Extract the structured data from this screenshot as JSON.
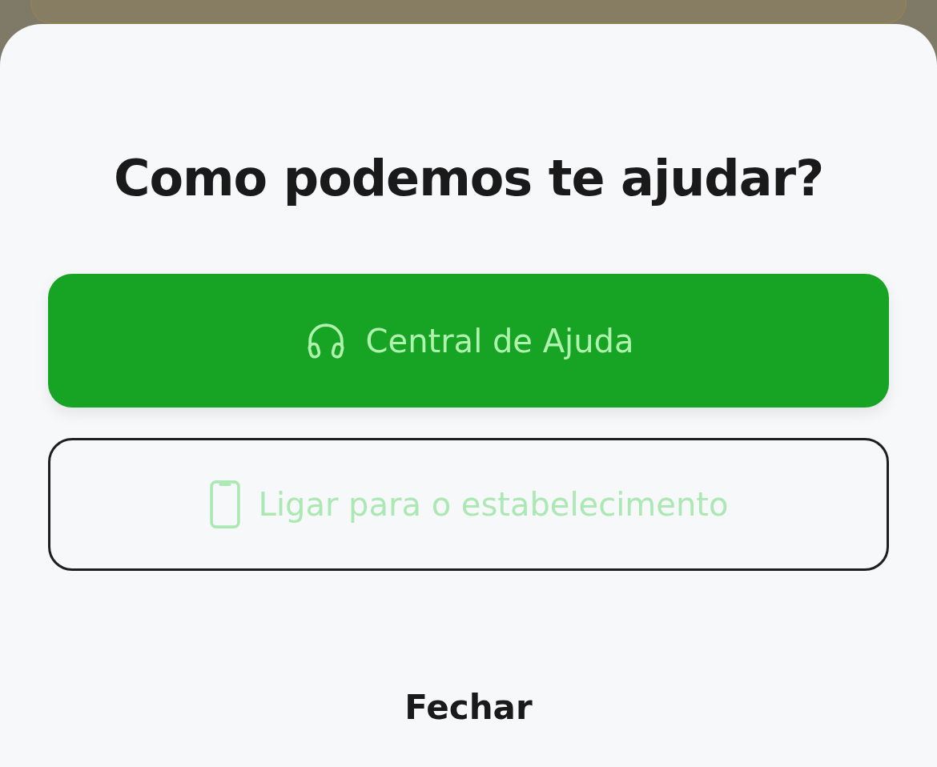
{
  "sheet": {
    "title": "Como podemos te ajudar?",
    "buttons": [
      {
        "kind": "primary",
        "label": "Central de Ajuda",
        "disabled": false
      },
      {
        "kind": "outline",
        "label": "Ligar para o estabelecimento",
        "disabled": true
      }
    ],
    "close": "Fechar"
  }
}
